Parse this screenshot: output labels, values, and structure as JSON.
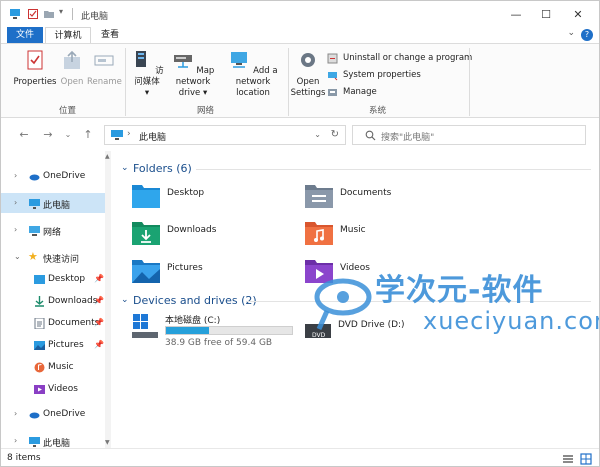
{
  "window": {
    "title": "此电脑"
  },
  "ribbon_tabs": {
    "file": "文件",
    "computer": "计算机",
    "view": "查看"
  },
  "ribbon": {
    "location_group": "位置",
    "network_group": "网络",
    "system_group": "系统",
    "properties": "Properties",
    "open": "Open",
    "rename": "Rename",
    "access_media": "访问媒体",
    "map_network_drive": "Map network drive",
    "add_network_location": "Add a network location",
    "open_settings": "Open Settings",
    "uninstall": "Uninstall or change a program",
    "system_properties": "System properties",
    "manage": "Manage"
  },
  "address": {
    "path": "此电脑",
    "search_placeholder": "搜索\"此电脑\""
  },
  "sidebar": {
    "items": [
      {
        "label": "OneDrive"
      },
      {
        "label": "此电脑"
      },
      {
        "label": "网络"
      },
      {
        "label": "快速访问"
      },
      {
        "label": "Desktop"
      },
      {
        "label": "Downloads"
      },
      {
        "label": "Documents"
      },
      {
        "label": "Pictures"
      },
      {
        "label": "Music"
      },
      {
        "label": "Videos"
      },
      {
        "label": "OneDrive"
      },
      {
        "label": "此电脑"
      }
    ]
  },
  "main": {
    "folders_title": "Folders (6)",
    "drives_title": "Devices and drives (2)",
    "folders": [
      {
        "label": "Desktop",
        "icon": "desktop-folder-icon"
      },
      {
        "label": "Documents",
        "icon": "documents-folder-icon"
      },
      {
        "label": "Downloads",
        "icon": "downloads-folder-icon"
      },
      {
        "label": "Music",
        "icon": "music-folder-icon"
      },
      {
        "label": "Pictures",
        "icon": "pictures-folder-icon"
      },
      {
        "label": "Videos",
        "icon": "videos-folder-icon"
      }
    ],
    "drives": [
      {
        "name": "本地磁盘 (C:)",
        "free": "38.9 GB free of 59.4 GB",
        "used_fraction": 0.345
      },
      {
        "name": "DVD Drive (D:)",
        "label": "DVD"
      }
    ]
  },
  "watermark": {
    "title": "学次元-软件",
    "subtitle": "xueciyuan.com"
  },
  "status": {
    "items": "8 items"
  },
  "colors": {
    "accent": "#1e6fc8",
    "selected": "#cce4f7",
    "section": "#1a4e8c",
    "drive_fill": "#26a0da"
  }
}
